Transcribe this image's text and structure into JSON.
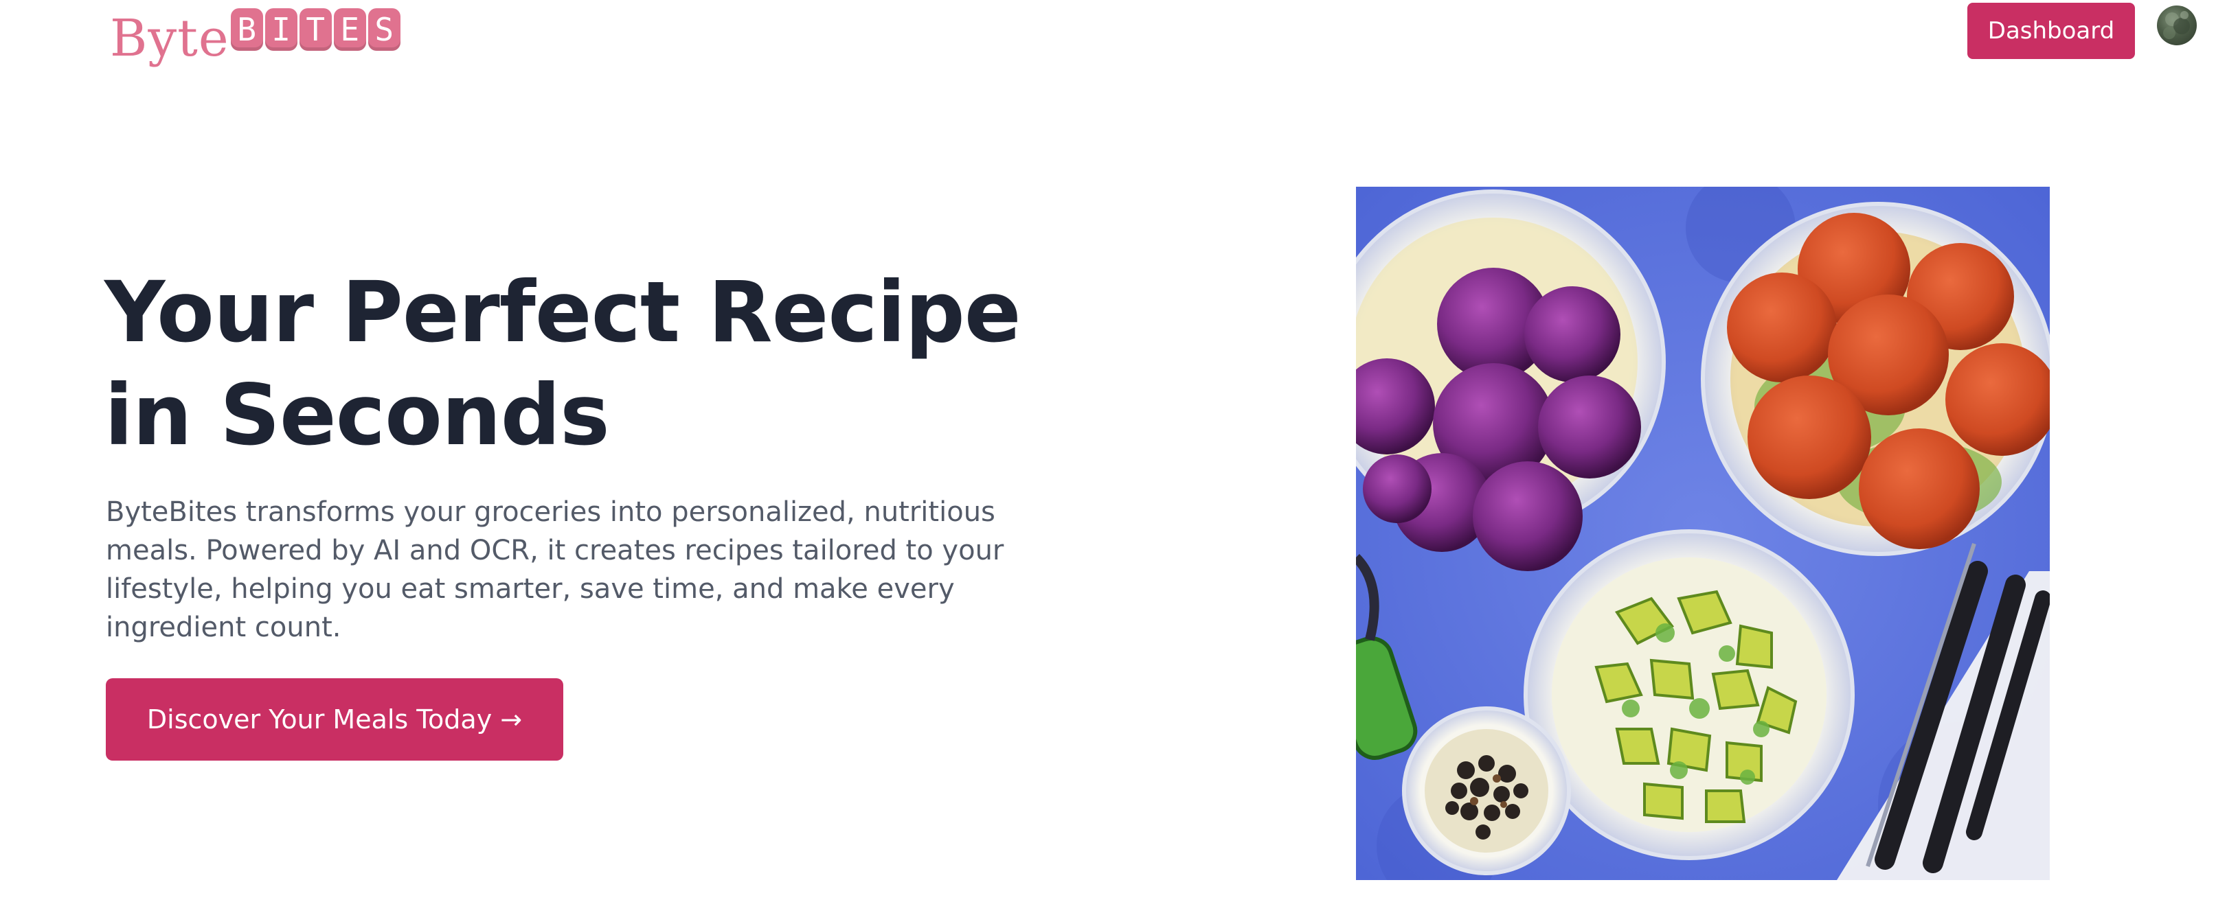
{
  "header": {
    "logo": {
      "prefix": "Byte",
      "tiles": [
        "B",
        "I",
        "T",
        "E",
        "S"
      ]
    },
    "dashboard_label": "Dashboard",
    "avatar_icon": "user-avatar"
  },
  "hero": {
    "title": "Your Perfect Recipe in Seconds",
    "description": "ByteBites transforms your groceries into personalized, nutritious meals. Powered by AI and OCR, it creates recipes tailored to your lifestyle, helping you eat smarter, save time, and make every ingredient count.",
    "cta_label": "Discover Your Meals Today →"
  },
  "colors": {
    "brand": "#c92f63",
    "logo_pink": "#e0728f",
    "heading": "#1e2433",
    "body_text": "#535a68",
    "image_background": "#5b73dd"
  }
}
